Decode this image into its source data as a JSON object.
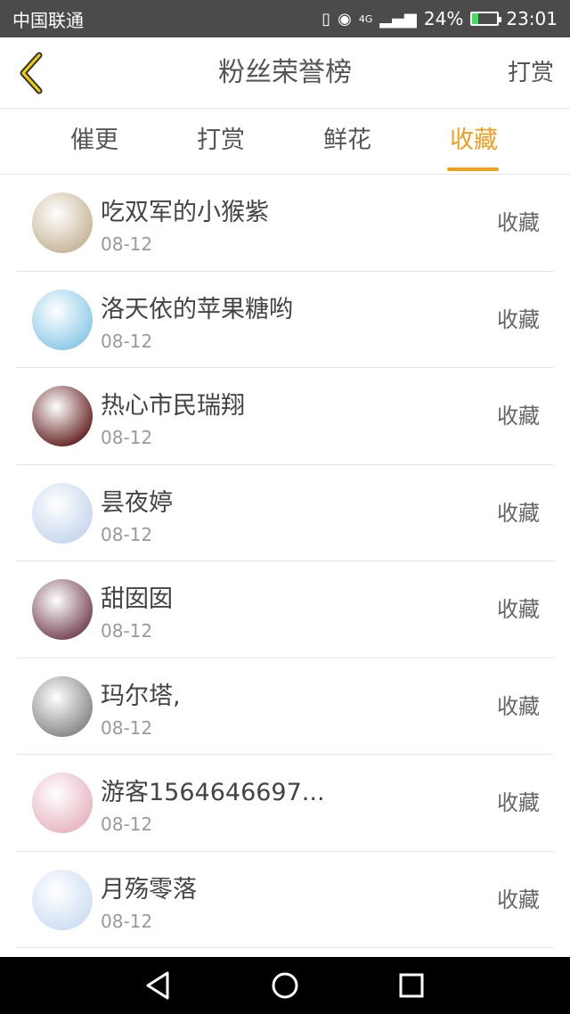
{
  "status_bar": {
    "carrier": "中国联通",
    "battery_percent": "24%",
    "time": "23:01",
    "network": "4G",
    "battery_level": 0.24
  },
  "header": {
    "title": "粉丝荣誉榜",
    "action_label": "打赏",
    "back_icon": "chevron-left-icon"
  },
  "tabs": [
    {
      "label": "催更",
      "active": false
    },
    {
      "label": "打赏",
      "active": false
    },
    {
      "label": "鲜花",
      "active": false
    },
    {
      "label": "收藏",
      "active": true
    }
  ],
  "colors": {
    "accent": "#f0a020",
    "text": "#444444",
    "subtext": "#9a9a9a",
    "status_bar": "#4b4b4b"
  },
  "list": [
    {
      "name": "吃双军的小猴紫",
      "date": "08-12",
      "action": "收藏",
      "avatar_color": "#c8b79a"
    },
    {
      "name": "洛天依的苹果糖哟",
      "date": "08-12",
      "action": "收藏",
      "avatar_color": "#8fcbe8"
    },
    {
      "name": "热心市民瑞翔",
      "date": "08-12",
      "action": "收藏",
      "avatar_color": "#6b2a2a"
    },
    {
      "name": "昙夜婷",
      "date": "08-12",
      "action": "收藏",
      "avatar_color": "#c8d8ee"
    },
    {
      "name": "甜囡囡",
      "date": "08-12",
      "action": "收藏",
      "avatar_color": "#7a4a5a"
    },
    {
      "name": "玛尔塔,",
      "date": "08-12",
      "action": "收藏",
      "avatar_color": "#8a8a8a"
    },
    {
      "name": "游客1564646697...",
      "date": "08-12",
      "action": "收藏",
      "avatar_color": "#e8b7c3"
    },
    {
      "name": "月殇零落",
      "date": "08-12",
      "action": "收藏",
      "avatar_color": "#cfe0f3"
    }
  ]
}
